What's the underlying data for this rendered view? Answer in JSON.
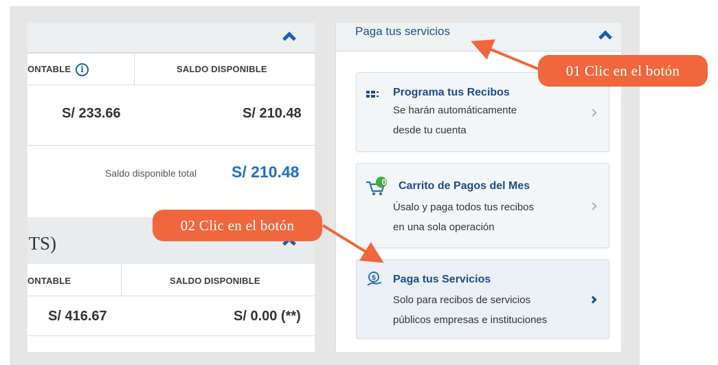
{
  "left_panel": {
    "account1": {
      "col_contable": "ONTABLE",
      "col_disponible": "SALDO DISPONIBLE",
      "contable_amount": "S/ 233.66",
      "disponible_amount": "S/ 210.48",
      "total_label": "Saldo disponible total",
      "total_value": "S/ 210.48"
    },
    "account2": {
      "title": ":TS)",
      "col_contable": "ONTABLE",
      "col_disponible": "SALDO DISPONIBLE",
      "contable_amount": "S/ 416.67",
      "disponible_amount": "S/ 0.00 (**)"
    }
  },
  "right_panel": {
    "title": "Paga tus servicios",
    "cards": [
      {
        "title": "Programa tus Recibos",
        "desc1": "Se harán automáticamente",
        "desc2": "desde tu cuenta",
        "icon": "receipts-icon"
      },
      {
        "title": "Carrito de Pagos del Mes",
        "desc1": "Úsalo y paga todos tus recibos",
        "desc2": "en una sola operación",
        "icon": "cart-icon",
        "badge": "0"
      },
      {
        "title": "Paga tus Servicios",
        "desc1": "Solo para recibos de servicios",
        "desc2": "públicos empresas e instituciones",
        "icon": "services-icon"
      }
    ]
  },
  "callouts": {
    "step1": "01 Clic en el botón",
    "step2": "02 Clic en el botón"
  },
  "colors": {
    "accent_blue": "#1b5eaa",
    "callout_orange": "#f0673e",
    "total_blue": "#1f6fc6"
  }
}
